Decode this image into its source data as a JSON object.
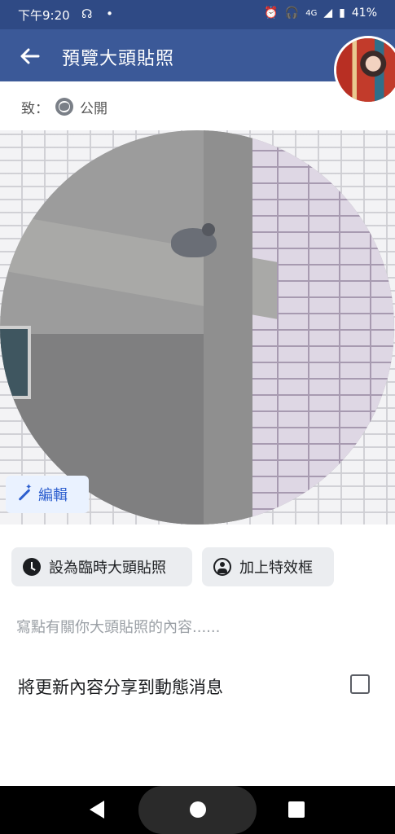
{
  "status_bar": {
    "time": "下午9:20",
    "left_icons": [
      "assistant-icon",
      "dot-icon"
    ],
    "network_label": "4G",
    "battery": "41%",
    "icon_names": [
      "alarm-icon",
      "headset-icon",
      "signal-icon",
      "battery-icon"
    ]
  },
  "app_bar": {
    "title": "預覽大頭貼照",
    "back_icon": "arrow-left-icon"
  },
  "audience": {
    "prefix": "致：",
    "value": "公開",
    "icon": "globe-icon"
  },
  "preview": {
    "edit_label": "編輯",
    "edit_icon": "magic-wand-icon"
  },
  "actions": {
    "temporary_label": "設為臨時大頭貼照",
    "temporary_icon": "clock-icon",
    "frame_label": "加上特效框",
    "frame_icon": "user-circle-icon"
  },
  "caption": {
    "placeholder": "寫點有關你大頭貼照的內容......"
  },
  "share": {
    "label": "將更新內容分享到動態消息",
    "checked": false
  },
  "nav": {
    "icons": [
      "back-triangle-icon",
      "home-circle-icon",
      "recent-square-icon"
    ]
  },
  "colors": {
    "status_bar": "#2f4a85",
    "app_bar": "#3b5998",
    "accent": "#2d5fcf",
    "button_bg": "#ebedf0"
  }
}
